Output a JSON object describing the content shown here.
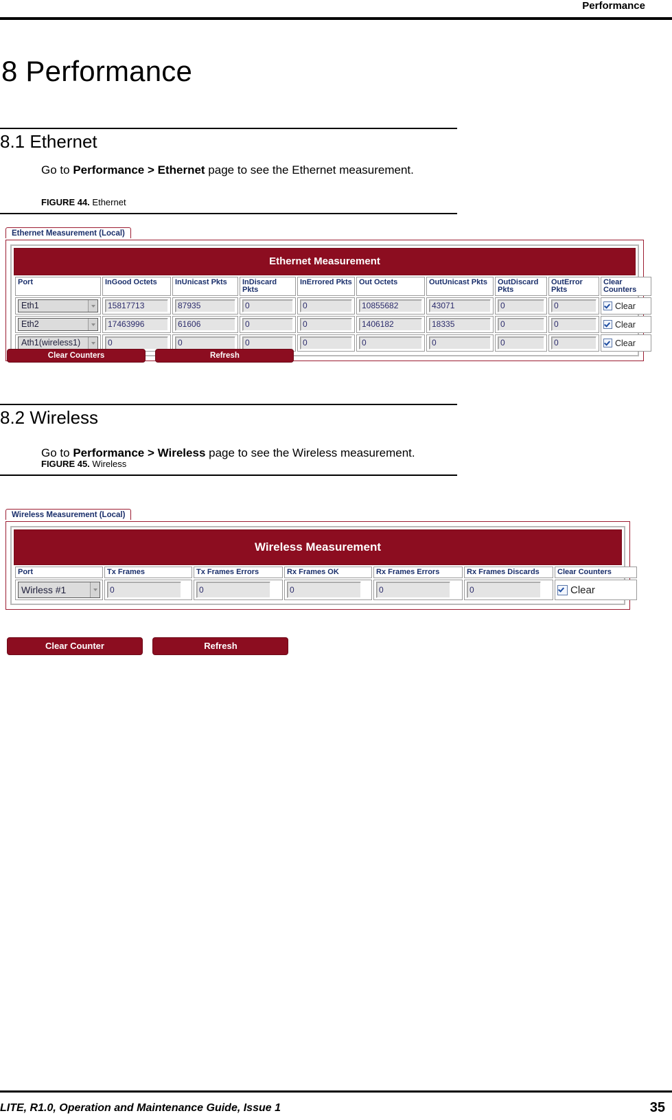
{
  "header": {
    "running_head": "Performance"
  },
  "chapter": {
    "title": "8 Performance"
  },
  "sections": [
    {
      "heading": "8.1 Ethernet",
      "body_before": "Go to ",
      "body_bold": "Performance > Ethernet",
      "body_after": " page to see the Ethernet measurement.",
      "figure_label": "FIGURE 44.",
      "figure_title": "Ethernet"
    },
    {
      "heading": "8.2 Wireless",
      "body_before": "Go to ",
      "body_bold": "Performance > Wireless",
      "body_after": " page to see the Wireless measurement.",
      "figure_label": "FIGURE 45.",
      "figure_title": "Wireless"
    }
  ],
  "ethernet_ui": {
    "tab_label": "Ethernet Measurement (Local)",
    "banner_title": "Ethernet Measurement",
    "columns": [
      "Port",
      "InGood Octets",
      "InUnicast Pkts",
      "InDiscard Pkts",
      "InErrored Pkts",
      "Out Octets",
      "OutUnicast Pkts",
      "OutDiscard Pkts",
      "OutError Pkts",
      "Clear Counters"
    ],
    "rows": [
      {
        "port": "Eth1",
        "ingood_octets": "15817713",
        "inunicast_pkts": "87935",
        "indiscard_pkts": "0",
        "inerrored_pkts": "0",
        "out_octets": "10855682",
        "outunicast_pkts": "43071",
        "outdiscard_pkts": "0",
        "outerror_pkts": "0",
        "clear_label": "Clear"
      },
      {
        "port": "Eth2",
        "ingood_octets": "17463996",
        "inunicast_pkts": "61606",
        "indiscard_pkts": "0",
        "inerrored_pkts": "0",
        "out_octets": "1406182",
        "outunicast_pkts": "18335",
        "outdiscard_pkts": "0",
        "outerror_pkts": "0",
        "clear_label": "Clear"
      },
      {
        "port": "Ath1(wireless1)",
        "ingood_octets": "0",
        "inunicast_pkts": "0",
        "indiscard_pkts": "0",
        "inerrored_pkts": "0",
        "out_octets": "0",
        "outunicast_pkts": "0",
        "outdiscard_pkts": "0",
        "outerror_pkts": "0",
        "clear_label": "Clear"
      }
    ],
    "buttons": {
      "clear": "Clear Counters",
      "refresh": "Refresh"
    }
  },
  "wireless_ui": {
    "tab_label": "Wireless Measurement (Local)",
    "banner_title": "Wireless Measurement",
    "columns": [
      "Port",
      "Tx Frames",
      "Tx Frames Errors",
      "Rx Frames OK",
      "Rx Frames Errors",
      "Rx Frames Discards",
      "Clear Counters"
    ],
    "rows": [
      {
        "port": "Wirless #1",
        "tx_frames": "0",
        "tx_frames_errors": "0",
        "rx_frames_ok": "0",
        "rx_frames_errors": "0",
        "rx_frames_discards": "0",
        "clear_label": "Clear"
      }
    ],
    "buttons": {
      "clear": "Clear Counter",
      "refresh": "Refresh"
    }
  },
  "footer": {
    "left": "LITE, R1.0, Operation and Maintenance Guide, Issue 1",
    "page": "35"
  }
}
